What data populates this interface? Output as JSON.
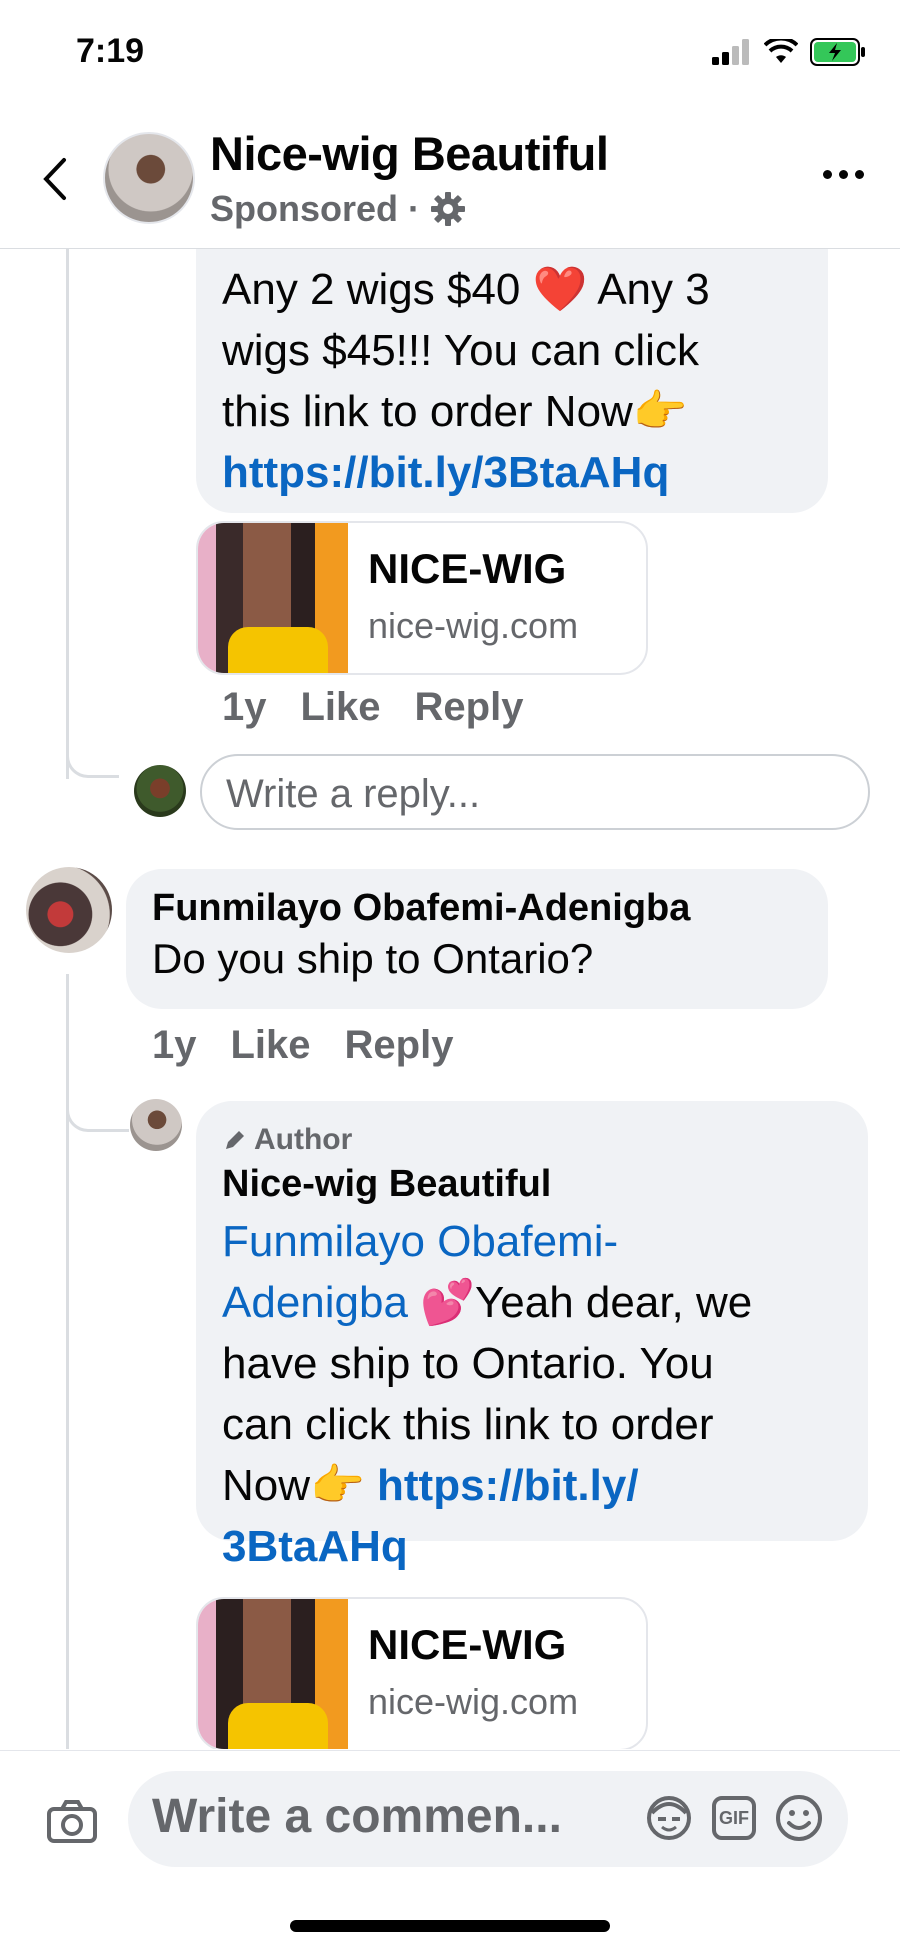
{
  "status": {
    "time": "7:19"
  },
  "header": {
    "name": "Nice-wig Beautiful",
    "sponsored": "Sponsored",
    "dot": "·"
  },
  "comments": {
    "first_reply": {
      "text_line1": "Any 2 wigs $40 ❤️ Any 3",
      "text_line2": "wigs $45!!! You can click",
      "text_line3": "this link to order Now👉",
      "link": "https://bit.ly/3BtaAHq",
      "preview_title": "NICE-WIG",
      "preview_domain": "nice-wig.com",
      "age": "1y",
      "like": "Like",
      "reply": "Reply"
    },
    "write_reply_placeholder": "Write a reply...",
    "second_comment": {
      "author": "Funmilayo Obafemi-Adenigba",
      "text": "Do you ship to Ontario?",
      "age": "1y",
      "like": "Like",
      "reply": "Reply"
    },
    "author_reply": {
      "badge": "Author",
      "author": "Nice-wig Beautiful",
      "mention_line1": "Funmilayo Obafemi-",
      "mention_line2": "Adenigba",
      "text_line1": " 💕Yeah dear, we",
      "text_line2": "have ship to Ontario. You",
      "text_line3": "can click this link to order",
      "text_line4": "Now👉 ",
      "link_line1": "https://bit.ly/",
      "link_line2": "3BtaAHq",
      "preview_title": "NICE-WIG",
      "preview_domain": "nice-wig.com"
    }
  },
  "composer": {
    "placeholder": "Write a commen...",
    "gif": "GIF"
  },
  "icons": {
    "back": "chevron-left-icon",
    "settings": "gear-icon",
    "more": "more-icon",
    "camera": "camera-icon",
    "avatar_sticker": "avatar-sticker-icon",
    "gif": "gif-icon",
    "emoji": "emoji-icon"
  },
  "colors": {
    "link": "#0a66c2",
    "bubble": "#f0f2f5",
    "meta": "#65676b",
    "battery": "#34c759"
  }
}
